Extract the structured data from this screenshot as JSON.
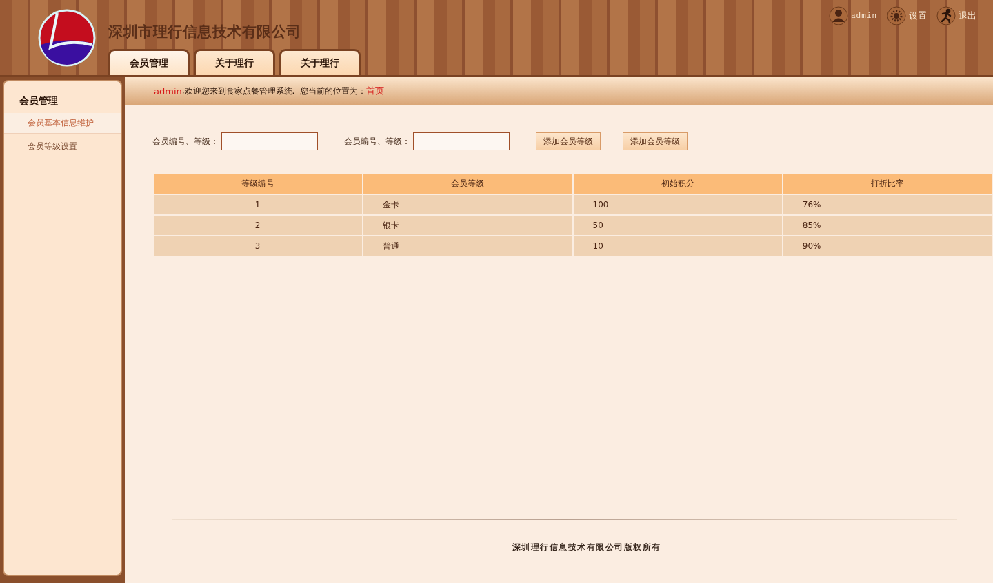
{
  "header": {
    "company": "深圳市理行信息技术有限公司",
    "tabs": [
      {
        "label": "会员管理",
        "selected": true
      },
      {
        "label": "关于理行",
        "selected": false
      },
      {
        "label": "关于理行",
        "selected": false
      }
    ],
    "user_links": [
      {
        "kind": "user",
        "label": "admin"
      },
      {
        "kind": "settings",
        "label": "设置"
      },
      {
        "kind": "logout",
        "label": "退出"
      }
    ]
  },
  "sidebar": {
    "title": "会员管理",
    "items": [
      {
        "label": "会员基本信息维护",
        "selected": true
      },
      {
        "label": "会员等级设置",
        "selected": false
      }
    ]
  },
  "welcome": {
    "user": "admin",
    "text": ",欢迎您来到食家点餐管理系统.  您当前的位置为：",
    "location": "首页"
  },
  "filters": [
    {
      "label": "会员编号、等级："
    },
    {
      "label": "会员编号、等级："
    }
  ],
  "buttons": [
    "添加会员等级",
    "添加会员等级"
  ],
  "table": {
    "columns": [
      "等级编号",
      "会员等级",
      "初始积分",
      "打折比率"
    ],
    "rows": [
      [
        "1",
        "金卡",
        "100",
        "76%"
      ],
      [
        "2",
        "银卡",
        "50",
        "85%"
      ],
      [
        "3",
        "普通",
        "10",
        "90%"
      ]
    ]
  },
  "footer": "深圳理行信息技术有限公司版权所有"
}
